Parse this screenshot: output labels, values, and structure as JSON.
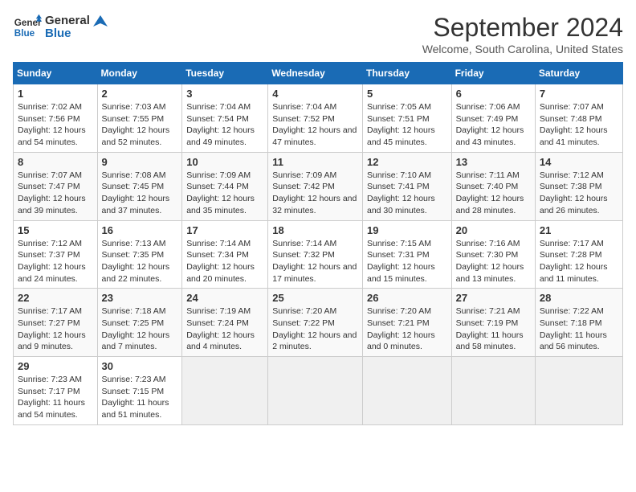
{
  "logo": {
    "line1": "General",
    "line2": "Blue"
  },
  "title": "September 2024",
  "subtitle": "Welcome, South Carolina, United States",
  "days_of_week": [
    "Sunday",
    "Monday",
    "Tuesday",
    "Wednesday",
    "Thursday",
    "Friday",
    "Saturday"
  ],
  "weeks": [
    [
      {
        "day": "1",
        "sunrise": "7:02 AM",
        "sunset": "7:56 PM",
        "daylight": "12 hours and 54 minutes."
      },
      {
        "day": "2",
        "sunrise": "7:03 AM",
        "sunset": "7:55 PM",
        "daylight": "12 hours and 52 minutes."
      },
      {
        "day": "3",
        "sunrise": "7:04 AM",
        "sunset": "7:54 PM",
        "daylight": "12 hours and 49 minutes."
      },
      {
        "day": "4",
        "sunrise": "7:04 AM",
        "sunset": "7:52 PM",
        "daylight": "12 hours and 47 minutes."
      },
      {
        "day": "5",
        "sunrise": "7:05 AM",
        "sunset": "7:51 PM",
        "daylight": "12 hours and 45 minutes."
      },
      {
        "day": "6",
        "sunrise": "7:06 AM",
        "sunset": "7:49 PM",
        "daylight": "12 hours and 43 minutes."
      },
      {
        "day": "7",
        "sunrise": "7:07 AM",
        "sunset": "7:48 PM",
        "daylight": "12 hours and 41 minutes."
      }
    ],
    [
      {
        "day": "8",
        "sunrise": "7:07 AM",
        "sunset": "7:47 PM",
        "daylight": "12 hours and 39 minutes."
      },
      {
        "day": "9",
        "sunrise": "7:08 AM",
        "sunset": "7:45 PM",
        "daylight": "12 hours and 37 minutes."
      },
      {
        "day": "10",
        "sunrise": "7:09 AM",
        "sunset": "7:44 PM",
        "daylight": "12 hours and 35 minutes."
      },
      {
        "day": "11",
        "sunrise": "7:09 AM",
        "sunset": "7:42 PM",
        "daylight": "12 hours and 32 minutes."
      },
      {
        "day": "12",
        "sunrise": "7:10 AM",
        "sunset": "7:41 PM",
        "daylight": "12 hours and 30 minutes."
      },
      {
        "day": "13",
        "sunrise": "7:11 AM",
        "sunset": "7:40 PM",
        "daylight": "12 hours and 28 minutes."
      },
      {
        "day": "14",
        "sunrise": "7:12 AM",
        "sunset": "7:38 PM",
        "daylight": "12 hours and 26 minutes."
      }
    ],
    [
      {
        "day": "15",
        "sunrise": "7:12 AM",
        "sunset": "7:37 PM",
        "daylight": "12 hours and 24 minutes."
      },
      {
        "day": "16",
        "sunrise": "7:13 AM",
        "sunset": "7:35 PM",
        "daylight": "12 hours and 22 minutes."
      },
      {
        "day": "17",
        "sunrise": "7:14 AM",
        "sunset": "7:34 PM",
        "daylight": "12 hours and 20 minutes."
      },
      {
        "day": "18",
        "sunrise": "7:14 AM",
        "sunset": "7:32 PM",
        "daylight": "12 hours and 17 minutes."
      },
      {
        "day": "19",
        "sunrise": "7:15 AM",
        "sunset": "7:31 PM",
        "daylight": "12 hours and 15 minutes."
      },
      {
        "day": "20",
        "sunrise": "7:16 AM",
        "sunset": "7:30 PM",
        "daylight": "12 hours and 13 minutes."
      },
      {
        "day": "21",
        "sunrise": "7:17 AM",
        "sunset": "7:28 PM",
        "daylight": "12 hours and 11 minutes."
      }
    ],
    [
      {
        "day": "22",
        "sunrise": "7:17 AM",
        "sunset": "7:27 PM",
        "daylight": "12 hours and 9 minutes."
      },
      {
        "day": "23",
        "sunrise": "7:18 AM",
        "sunset": "7:25 PM",
        "daylight": "12 hours and 7 minutes."
      },
      {
        "day": "24",
        "sunrise": "7:19 AM",
        "sunset": "7:24 PM",
        "daylight": "12 hours and 4 minutes."
      },
      {
        "day": "25",
        "sunrise": "7:20 AM",
        "sunset": "7:22 PM",
        "daylight": "12 hours and 2 minutes."
      },
      {
        "day": "26",
        "sunrise": "7:20 AM",
        "sunset": "7:21 PM",
        "daylight": "12 hours and 0 minutes."
      },
      {
        "day": "27",
        "sunrise": "7:21 AM",
        "sunset": "7:19 PM",
        "daylight": "11 hours and 58 minutes."
      },
      {
        "day": "28",
        "sunrise": "7:22 AM",
        "sunset": "7:18 PM",
        "daylight": "11 hours and 56 minutes."
      }
    ],
    [
      {
        "day": "29",
        "sunrise": "7:23 AM",
        "sunset": "7:17 PM",
        "daylight": "11 hours and 54 minutes."
      },
      {
        "day": "30",
        "sunrise": "7:23 AM",
        "sunset": "7:15 PM",
        "daylight": "11 hours and 51 minutes."
      },
      null,
      null,
      null,
      null,
      null
    ]
  ],
  "labels": {
    "sunrise": "Sunrise:",
    "sunset": "Sunset:",
    "daylight": "Daylight:"
  }
}
